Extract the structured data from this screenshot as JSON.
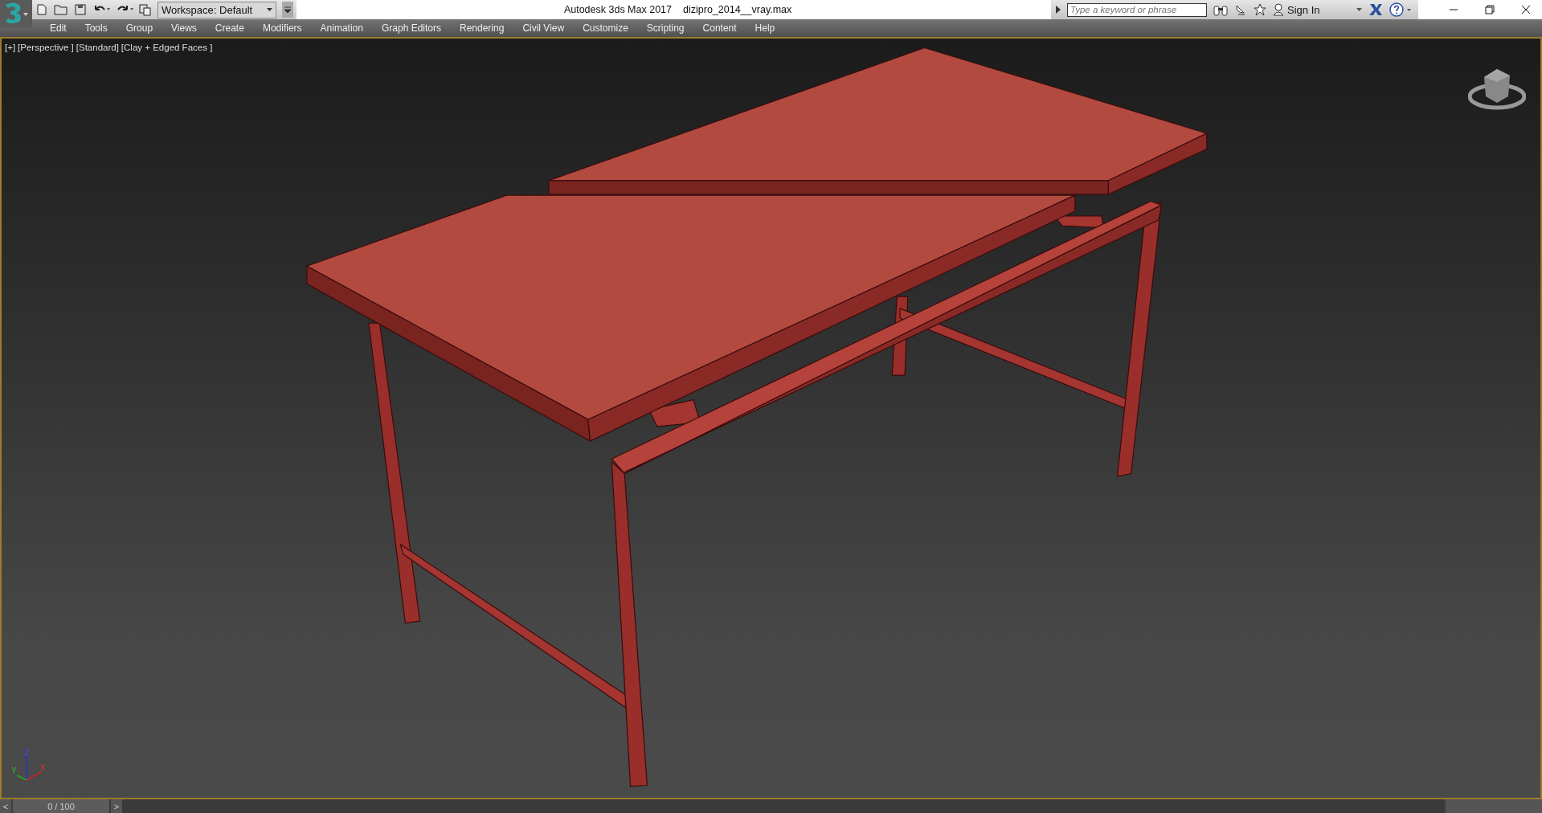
{
  "window": {
    "app_title": "Autodesk 3ds Max 2017",
    "file_name": "dizipro_2014__vray.max"
  },
  "toolbar": {
    "workspace": "Workspace: Default"
  },
  "search": {
    "placeholder": "Type a keyword or phrase"
  },
  "account": {
    "sign_in": "Sign In"
  },
  "menu": [
    "Edit",
    "Tools",
    "Group",
    "Views",
    "Create",
    "Modifiers",
    "Animation",
    "Graph Editors",
    "Rendering",
    "Civil View",
    "Customize",
    "Scripting",
    "Content",
    "Help"
  ],
  "viewport": {
    "labels": [
      "[+]",
      "[Perspective ]",
      "[Standard]",
      "[Clay + Edged Faces ]"
    ],
    "axes": [
      "X",
      "Y",
      "Z"
    ]
  },
  "timeline": {
    "prev": "<",
    "frame": "0 / 100",
    "level": 0,
    "next": ">"
  }
}
